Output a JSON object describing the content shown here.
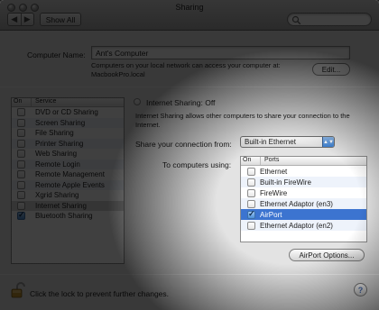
{
  "window": {
    "title": "Sharing"
  },
  "toolbar": {
    "back": "◀",
    "forward": "▶",
    "show_all": "Show All",
    "search_placeholder": ""
  },
  "computer": {
    "label": "Computer Name:",
    "name": "Ant's Computer",
    "help_line1": "Computers on your local network can access your computer at:",
    "help_line2": "MacbookPro.local",
    "edit_button": "Edit..."
  },
  "services": {
    "header_on": "On",
    "header_service": "Service",
    "items": [
      {
        "label": "DVD or CD Sharing",
        "checked": false
      },
      {
        "label": "Screen Sharing",
        "checked": false
      },
      {
        "label": "File Sharing",
        "checked": false
      },
      {
        "label": "Printer Sharing",
        "checked": false
      },
      {
        "label": "Web Sharing",
        "checked": false
      },
      {
        "label": "Remote Login",
        "checked": false
      },
      {
        "label": "Remote Management",
        "checked": false
      },
      {
        "label": "Remote Apple Events",
        "checked": false
      },
      {
        "label": "Xgrid Sharing",
        "checked": false
      },
      {
        "label": "Internet Sharing",
        "checked": false
      },
      {
        "label": "Bluetooth Sharing",
        "checked": true
      }
    ],
    "selected": "Internet Sharing"
  },
  "internet_sharing": {
    "status": "Internet Sharing: Off",
    "description_line1": "Internet Sharing allows other computers to share your connection to the",
    "description_line2": "Internet.",
    "share_from_label": "Share your connection from:",
    "share_from_value": "Built-in Ethernet",
    "to_label": "To computers using:",
    "ports_header_on": "On",
    "ports_header_ports": "Ports",
    "ports": [
      {
        "label": "Ethernet",
        "checked": false
      },
      {
        "label": "Built-in FireWire",
        "checked": false
      },
      {
        "label": "FireWire",
        "checked": false
      },
      {
        "label": "Ethernet Adaptor (en3)",
        "checked": false
      },
      {
        "label": "AirPort",
        "checked": true
      },
      {
        "label": "Ethernet Adaptor (en2)",
        "checked": false
      }
    ],
    "airport_options": "AirPort Options..."
  },
  "footer": {
    "lock_text": "Click the lock to prevent further changes.",
    "help": "?"
  },
  "colors": {
    "selection": "#3c74d0",
    "row_alt": "#eef3fb",
    "window_bg": "#e3e3e3"
  }
}
